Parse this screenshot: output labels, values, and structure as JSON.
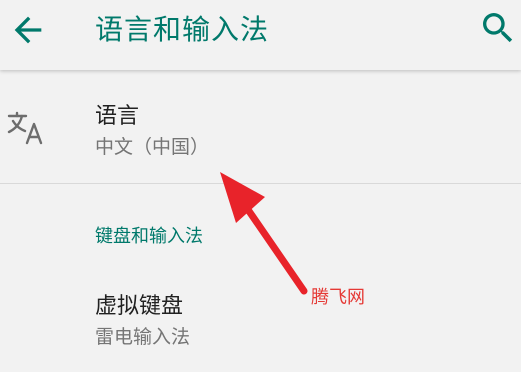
{
  "appbar": {
    "title": "语言和输入法",
    "back_icon": "arrow-back-icon",
    "search_icon": "search-icon"
  },
  "language": {
    "icon": "translate-icon",
    "title": "语言",
    "summary": "中文（中国）"
  },
  "keyboard_section": {
    "category_title": "键盘和输入法",
    "virtual_keyboard": {
      "title": "虚拟键盘",
      "summary": "雷电输入法"
    }
  },
  "annotation": {
    "watermark_text": "腾飞网",
    "arrow_color": "#e8232a"
  },
  "colors": {
    "accent": "#00796b",
    "background": "#f2f2f2",
    "primary_text": "#212121",
    "secondary_text": "#757575"
  }
}
